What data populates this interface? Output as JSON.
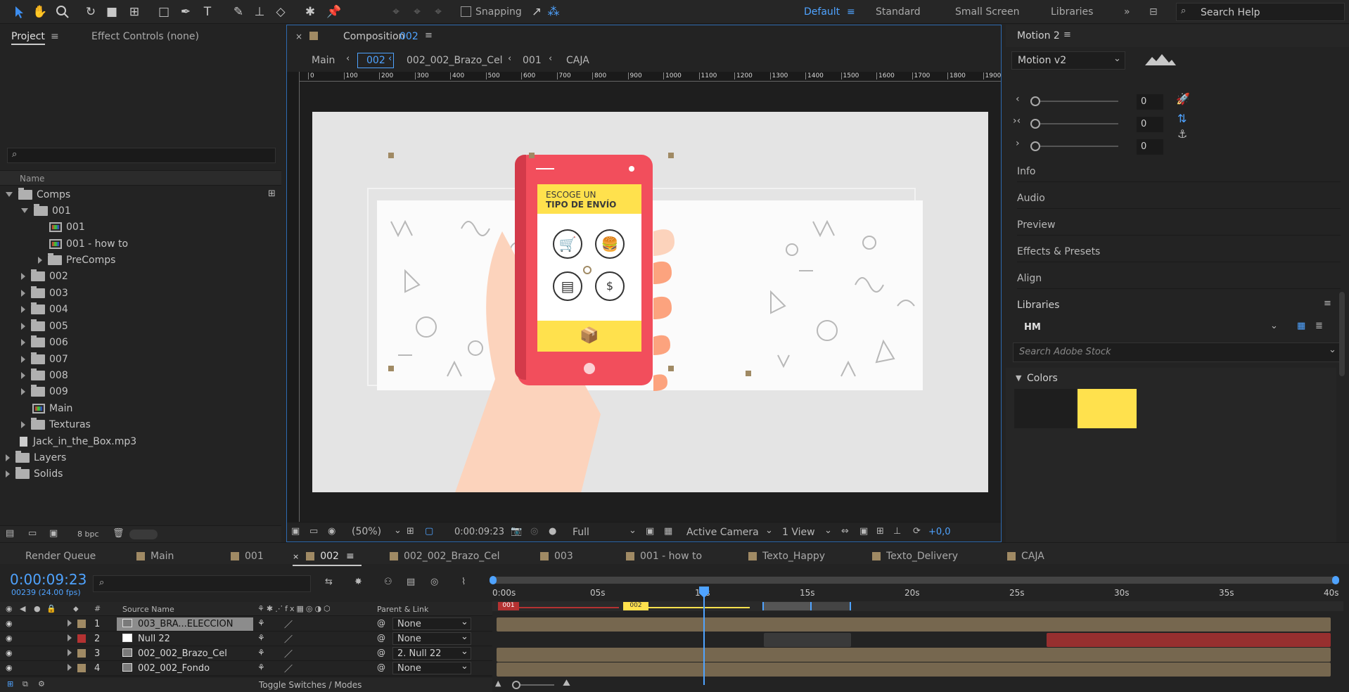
{
  "toolbar": {
    "snapping": "Snapping",
    "workspaces": [
      "Default",
      "Standard",
      "Small Screen",
      "Libraries"
    ],
    "search": "Search Help"
  },
  "project": {
    "tab": "Project",
    "tab2": "Effect Controls (none)",
    "col_name": "Name",
    "items": [
      "Comps",
      "001",
      "001",
      "001 - how to",
      "PreComps",
      "002",
      "003",
      "004",
      "005",
      "006",
      "007",
      "008",
      "009",
      "Main",
      "Texturas",
      "Jack_in_the_Box.mp3",
      "Layers",
      "Solids"
    ],
    "bpc": "8 bpc"
  },
  "comp": {
    "tab_prefix": "Composition",
    "tab_name": "002",
    "breadcrumb": [
      "Main",
      "002",
      "002_002_Brazo_Cel",
      "001",
      "CAJA"
    ],
    "ruler": [
      "0",
      "100",
      "200",
      "300",
      "400",
      "500",
      "600",
      "700",
      "800",
      "900",
      "1000",
      "1100",
      "1200",
      "1300",
      "1400",
      "1500",
      "1600",
      "1700",
      "1800",
      "1900"
    ],
    "zoom": "(50%)",
    "timecode": "0:00:09:23",
    "quality": "Full",
    "camera": "Active Camera",
    "view": "1 View",
    "exposure": "+0,0"
  },
  "phone": {
    "line1": "ESCOGE UN",
    "line2": "TIPO DE ENVÍO"
  },
  "motion": {
    "tab": "Motion 2",
    "preset": "Motion v2",
    "values": [
      "0",
      "0",
      "0"
    ]
  },
  "side_panels": [
    "Info",
    "Audio",
    "Preview",
    "Effects & Presets",
    "Align"
  ],
  "libraries": {
    "title": "Libraries",
    "lib": "HM",
    "search": "Search Adobe Stock",
    "colors": "Colors",
    "swatch": "#ffe14d"
  },
  "timeline": {
    "tabs": [
      "Render Queue",
      "Main",
      "001",
      "002",
      "002_002_Brazo_Cel",
      "003",
      "001 - how to",
      "Texto_Happy",
      "Texto_Delivery",
      "CAJA"
    ],
    "timecode": "0:00:09:23",
    "fps": "00239 (24.00 fps)",
    "ticks": [
      "0:00s",
      "05s",
      "10s",
      "15s",
      "20s",
      "25s",
      "30s",
      "35s",
      "40s"
    ],
    "col_source": "Source Name",
    "col_parent": "Parent & Link",
    "layers": [
      {
        "num": "1",
        "name": "003_BRA...ELECCION",
        "parent": "None",
        "color": "#a08a64"
      },
      {
        "num": "2",
        "name": "Null 22",
        "parent": "None",
        "color": "#b43232"
      },
      {
        "num": "3",
        "name": "002_002_Brazo_Cel",
        "parent": "2. Null 22",
        "color": "#a08a64"
      },
      {
        "num": "4",
        "name": "002_002_Fondo",
        "parent": "None",
        "color": "#a08a64"
      }
    ],
    "markers": [
      "001",
      "002"
    ],
    "toggle": "Toggle Switches / Modes"
  }
}
